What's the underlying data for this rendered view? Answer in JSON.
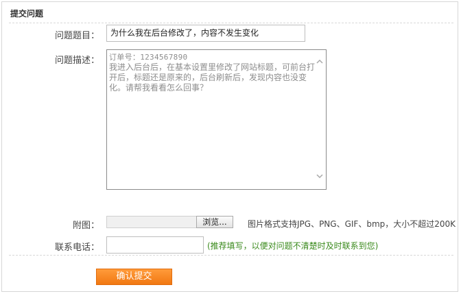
{
  "panel": {
    "title": "提交问题"
  },
  "form": {
    "title_label": "问题题目：",
    "title_value": "为什么我在后台修改了，内容不发生变化",
    "desc_label": "问题描述：",
    "desc_order_line": "订单号：1234567890",
    "desc_body": "我进入后台后，在基本设置里修改了网站标题，可前台打开后，标题还是原来的，后台刷新后，发现内容也没变化。请帮我看看怎么回事？",
    "attach_label": "附图：",
    "browse_label": "浏览...",
    "attach_hint": "图片格式支持JPG、PNG、GIF、bmp，大小不超过200K",
    "phone_label": "联系电话：",
    "phone_value": "",
    "phone_hint": "(推荐填写，以便对问题不清楚时及时联系到您)",
    "submit_label": "确认提交"
  },
  "colors": {
    "submit_bg": "#f5861f",
    "hint_green": "#3a8a1c",
    "border": "#d6d6d6"
  },
  "icons": {
    "scroll_up": "chevron-up-icon",
    "scroll_down": "chevron-down-icon"
  }
}
